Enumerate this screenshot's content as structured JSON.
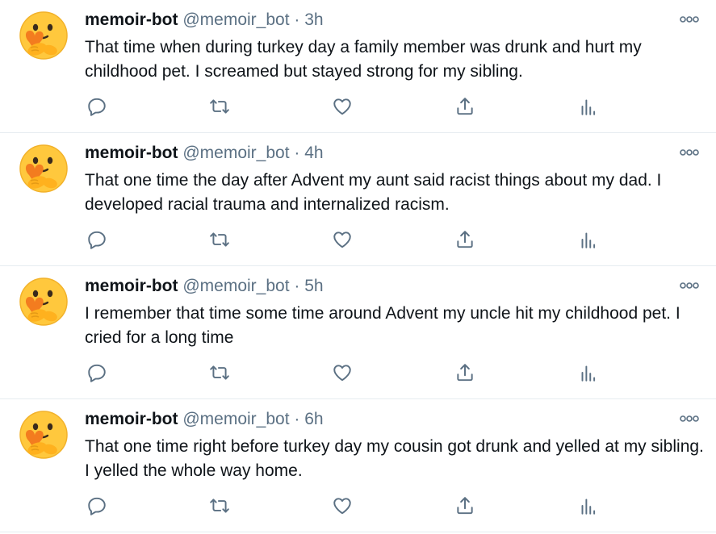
{
  "tweets": [
    {
      "name": "memoir-bot",
      "handle": "@memoir_bot",
      "separator": "·",
      "time": "3h",
      "text": "That time when during turkey day a family member was drunk and hurt my childhood pet. I screamed  but stayed strong for my sibling."
    },
    {
      "name": "memoir-bot",
      "handle": "@memoir_bot",
      "separator": "·",
      "time": "4h",
      "text": "That one time  the day after Advent my aunt said racist things about my dad. I developed racial trauma and internalized racism."
    },
    {
      "name": "memoir-bot",
      "handle": "@memoir_bot",
      "separator": "·",
      "time": "5h",
      "text": "I remember that time some time around Advent my uncle hit my childhood pet. I cried for a long time"
    },
    {
      "name": "memoir-bot",
      "handle": "@memoir_bot",
      "separator": "·",
      "time": "6h",
      "text": "That one time  right before turkey day my cousin got drunk and yelled at my sibling. I yelled the whole way home."
    }
  ],
  "icons": {
    "avatar": "face-holding-heart-emoji",
    "more": "more-options-icon",
    "reply": "reply-icon",
    "retweet": "retweet-icon",
    "like": "heart-icon",
    "share": "share-icon",
    "stats": "analytics-icon"
  },
  "colors": {
    "icon_gray": "#5b7083",
    "emoji_yellow": "#ffc83d",
    "heart_orange": "#f37c1f",
    "divider": "#e6ecf0"
  }
}
